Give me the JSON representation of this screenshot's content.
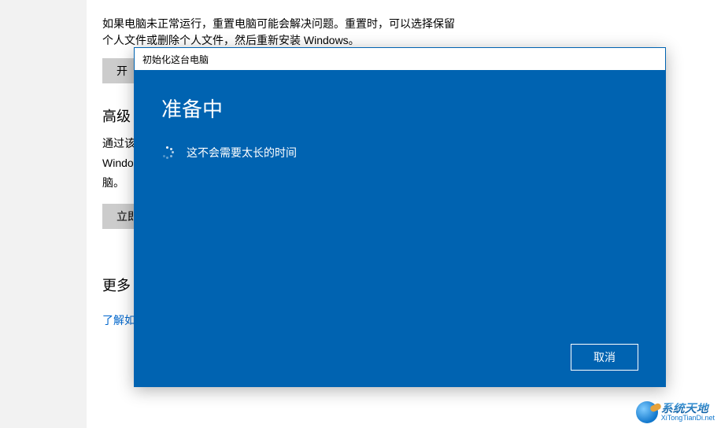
{
  "background": {
    "reset_desc_line1": "如果电脑未正常运行，重置电脑可能会解决问题。重置时，可以选择保留",
    "reset_desc_line2": "个人文件或删除个人文件，然后重新安装 Windows。",
    "reset_button_partial": "开",
    "adv_heading_partial": "高级",
    "adv_desc_line1_partial": "通过该",
    "adv_desc_line2_partial": "Windo",
    "adv_desc_line3_partial": "脑。",
    "adv_button_partial": "立即",
    "more_heading_partial": "更多",
    "more_link_partial": "了解如"
  },
  "dialog": {
    "title": "初始化这台电脑",
    "heading": "准备中",
    "status_text": "这不会需要太长的时间",
    "cancel_label": "取消"
  },
  "watermark": {
    "text_cn": "系统天地",
    "text_url": "XiTongTianDi.net"
  }
}
